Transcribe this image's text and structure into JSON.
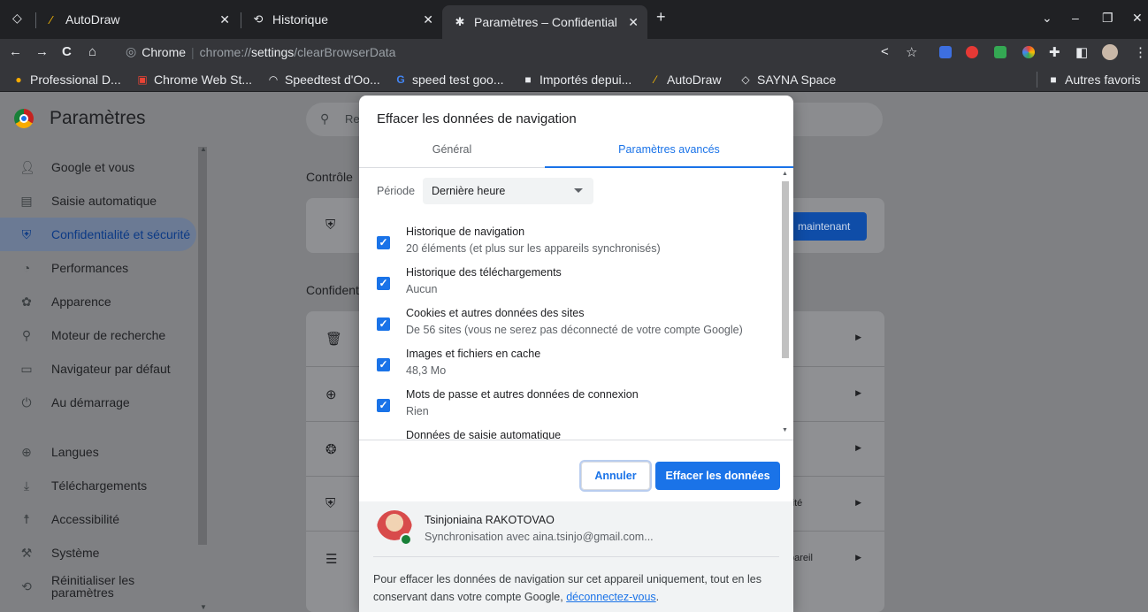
{
  "tabs": [
    {
      "title": "AutoDraw",
      "icon": "autodraw-icon"
    },
    {
      "title": "Historique",
      "icon": "history-icon"
    },
    {
      "title": "Paramètres – Confidential",
      "icon": "settings-gear-icon"
    }
  ],
  "toolbar": {
    "url_host": "Chrome",
    "url_prefix": "chrome://",
    "url_bold": "settings",
    "url_suffix": "/clearBrowserData"
  },
  "bookmarks": [
    {
      "label": "Professional D...",
      "icon": "bookmark-icon"
    },
    {
      "label": "Chrome Web St...",
      "icon": "webstore-icon"
    },
    {
      "label": "Speedtest d'Oo...",
      "icon": "speedtest-icon"
    },
    {
      "label": "speed test goo...",
      "icon": "google-icon"
    },
    {
      "label": "Importés depui...",
      "icon": "folder-icon"
    },
    {
      "label": "AutoDraw",
      "icon": "autodraw-icon"
    },
    {
      "label": "SAYNA Space",
      "icon": "sayna-icon"
    }
  ],
  "bookmarks_other": "Autres favoris",
  "sidebar": {
    "title": "Paramètres",
    "items": [
      {
        "label": "Google et vous",
        "icon": "person-icon"
      },
      {
        "label": "Saisie automatique",
        "icon": "clipboard-icon"
      },
      {
        "label": "Confidentialité et sécurité",
        "icon": "shield-icon"
      },
      {
        "label": "Performances",
        "icon": "speedometer-icon"
      },
      {
        "label": "Apparence",
        "icon": "palette-icon"
      },
      {
        "label": "Moteur de recherche",
        "icon": "search-icon"
      },
      {
        "label": "Navigateur par défaut",
        "icon": "browser-icon"
      },
      {
        "label": "Au démarrage",
        "icon": "power-icon"
      },
      {
        "label": "Langues",
        "icon": "globe-icon"
      },
      {
        "label": "Téléchargements",
        "icon": "download-icon"
      },
      {
        "label": "Accessibilité",
        "icon": "accessibility-icon"
      },
      {
        "label": "Système",
        "icon": "wrench-icon"
      },
      {
        "label": "Réinitialiser les paramètres",
        "icon": "reset-icon"
      }
    ]
  },
  "background": {
    "search_placeholder": "Re",
    "section1": "Contrôle",
    "section2": "Confident",
    "button": "maintenant",
    "row_partial": "rité",
    "row_partial2": "pareil"
  },
  "dialog": {
    "title": "Effacer les données de navigation",
    "tab_general": "Général",
    "tab_advanced": "Paramètres avancés",
    "period_label": "Période",
    "period_value": "Dernière heure",
    "options": [
      {
        "title": "Historique de navigation",
        "sub": "20 éléments (et plus sur les appareils synchronisés)",
        "checked": true
      },
      {
        "title": "Historique des téléchargements",
        "sub": "Aucun",
        "checked": true
      },
      {
        "title": "Cookies et autres données des sites",
        "sub": "De 56 sites (vous ne serez pas déconnecté de votre compte Google)",
        "checked": true
      },
      {
        "title": "Images et fichiers en cache",
        "sub": "48,3 Mo",
        "checked": true
      },
      {
        "title": "Mots de passe et autres données de connexion",
        "sub": "Rien",
        "checked": true
      },
      {
        "title": "Données de saisie automatique",
        "sub": "",
        "checked": true
      }
    ],
    "cancel": "Annuler",
    "clear": "Effacer les données",
    "account_name": "Tsinjoniaina RAKOTOVAO",
    "account_sync": "Synchronisation avec aina.tsinjo@gmail.com...",
    "note_text": "Pour effacer les données de navigation sur cet appareil uniquement, tout en les conservant dans votre compte Google, ",
    "note_link": "déconnectez-vous",
    "note_end": "."
  },
  "colors": {
    "accent": "#1a73e8",
    "dialog_bg": "#ffffff",
    "page_scrim": "#7f8083"
  }
}
